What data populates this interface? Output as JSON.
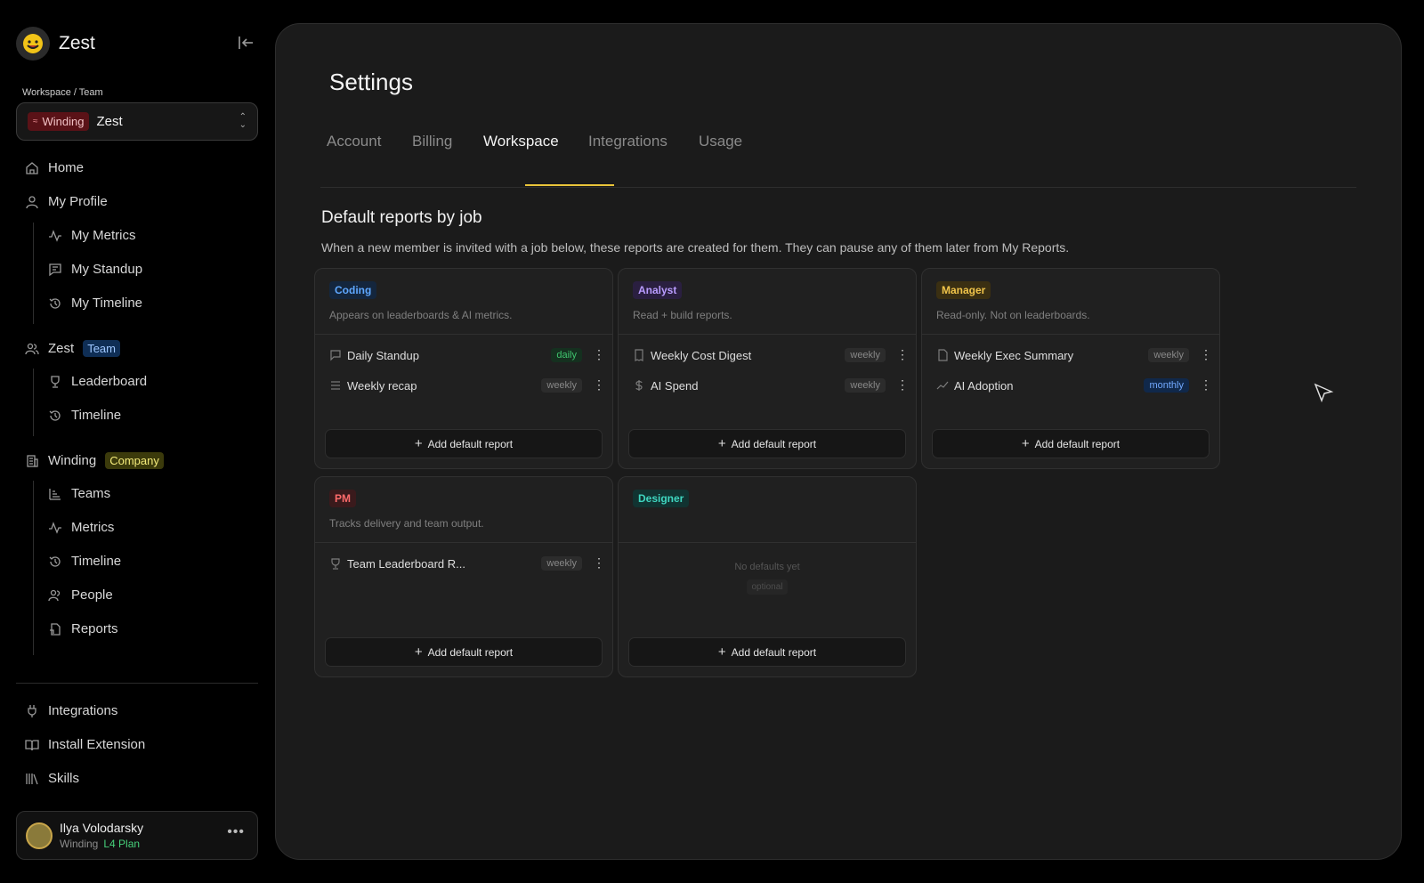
{
  "app": {
    "name": "Zest"
  },
  "workspace": {
    "label": "Workspace / Team",
    "company_chip": "Winding",
    "team": "Zest"
  },
  "nav": {
    "home": "Home",
    "my_profile": "My Profile",
    "my_metrics": "My Metrics",
    "my_standup": "My Standup",
    "my_timeline": "My Timeline",
    "team_name": "Zest",
    "team_badge": "Team",
    "leaderboard": "Leaderboard",
    "team_timeline": "Timeline",
    "company_name": "Winding",
    "company_badge": "Company",
    "teams": "Teams",
    "metrics": "Metrics",
    "company_timeline": "Timeline",
    "people": "People",
    "reports": "Reports",
    "integrations": "Integrations",
    "install_extension": "Install Extension",
    "skills": "Skills"
  },
  "user": {
    "name": "Ilya Volodarsky",
    "org": "Winding",
    "plan": "L4 Plan"
  },
  "page": {
    "title": "Settings",
    "tabs": [
      "Account",
      "Billing",
      "Workspace",
      "Integrations",
      "Usage"
    ],
    "active_tab": "Workspace",
    "section_title": "Default reports by job",
    "section_desc": "When a new member is invited with a job below, these reports are created for them. They can pause any of them later from My Reports."
  },
  "add_label": "Add default report",
  "cards": [
    {
      "job": "Coding",
      "color": "#5fa8ff",
      "bg": "#14263d",
      "desc": "Appears on leaderboards & AI metrics.",
      "reports": [
        {
          "name": "Daily Standup",
          "freq": "daily",
          "icon": "chat-icon"
        },
        {
          "name": "Weekly recap",
          "freq": "weekly",
          "icon": "list-icon"
        }
      ]
    },
    {
      "job": "Analyst",
      "color": "#b99cff",
      "bg": "#2a1f40",
      "desc": "Read + build reports.",
      "reports": [
        {
          "name": "Weekly Cost Digest",
          "freq": "weekly",
          "icon": "receipt-icon"
        },
        {
          "name": "AI Spend",
          "freq": "weekly",
          "icon": "dollar-icon"
        }
      ]
    },
    {
      "job": "Manager",
      "color": "#f0c44a",
      "bg": "#3a2f12",
      "desc": "Read-only. Not on leaderboards.",
      "reports": [
        {
          "name": "Weekly Exec Summary",
          "freq": "weekly",
          "icon": "document-icon"
        },
        {
          "name": "AI Adoption",
          "freq": "monthly",
          "icon": "trend-icon"
        }
      ]
    },
    {
      "job": "PM",
      "color": "#ff6b6b",
      "bg": "#3a1a1c",
      "desc": "Tracks delivery and team output.",
      "reports": [
        {
          "name": "Team Leaderboard R...",
          "freq": "weekly",
          "icon": "trophy-icon"
        }
      ]
    },
    {
      "job": "Designer",
      "color": "#3fd6c0",
      "bg": "#113331",
      "desc": "",
      "empty": "No defaults yet",
      "empty_tag": "optional",
      "reports": []
    }
  ]
}
